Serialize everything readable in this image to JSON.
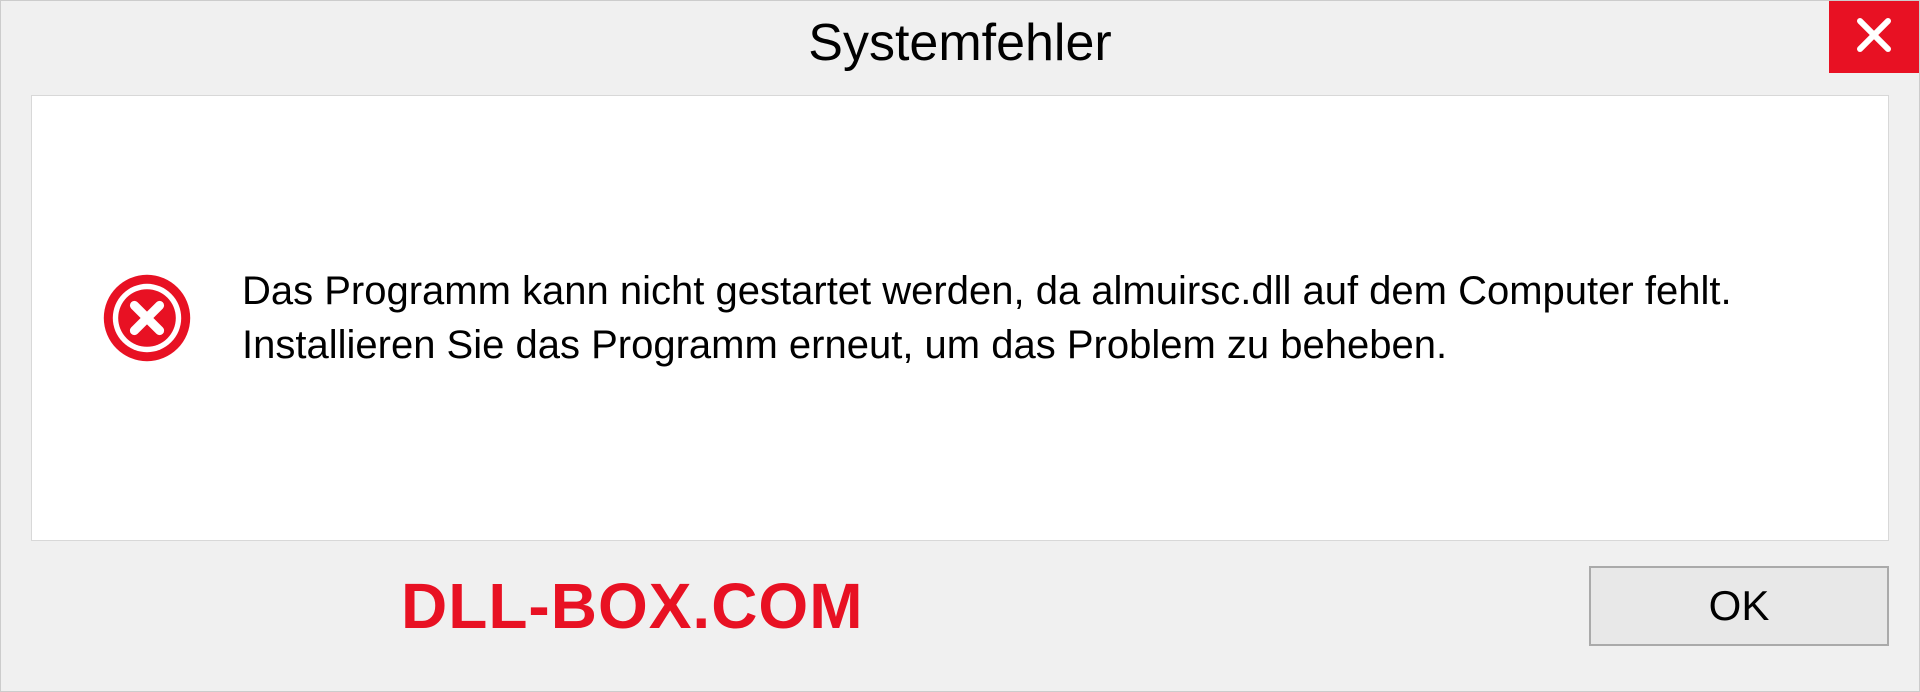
{
  "dialog": {
    "title": "Systemfehler",
    "message": "Das Programm kann nicht gestartet werden, da almuirsc.dll auf dem Computer fehlt. Installieren Sie das Programm erneut, um das Problem zu beheben.",
    "ok_label": "OK"
  },
  "watermark": "DLL-BOX.COM",
  "colors": {
    "close_red": "#e81123",
    "watermark_red": "#e81123"
  }
}
